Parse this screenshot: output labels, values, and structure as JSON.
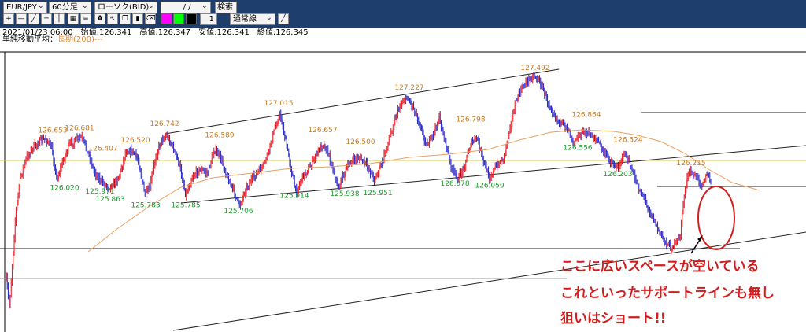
{
  "toolbar": {
    "symbol": "EUR/JPY",
    "timeframe": "60分足",
    "chart_style": "ローソク(BID)",
    "date_input": "/ /",
    "search_button": "検索",
    "line_width": "1",
    "line_type": "通常線",
    "bg_color": "#1e3f6d",
    "swatch_colors": [
      "#ff00ff",
      "#00ff00",
      "#000000"
    ]
  },
  "info": {
    "datetime": "2021/01/23 06:00",
    "open": "始値:126.341",
    "high": "高値:126.347",
    "low": "安値:126.341",
    "close": "終値:126.345",
    "indicator_label": "単純移動平均",
    "indicator_value": "長期(200)"
  },
  "annotation": {
    "lines": [
      "ここに広いスペースが空いている",
      "これといったサポートラインも無し",
      "狙いはショート!!"
    ],
    "color": "#d31c1c"
  },
  "chart_data": {
    "type": "candlestick",
    "symbol": "EUR/JPY",
    "timeframe": "60分足",
    "moving_average": "単純移動平均 長期(200)",
    "high_labels": [
      {
        "value": 126.653,
        "label": "126.653"
      },
      {
        "value": 126.681,
        "label": "126.681"
      },
      {
        "value": 126.407,
        "label": "126.407"
      },
      {
        "value": 126.52,
        "label": "126.520"
      },
      {
        "value": 126.742,
        "label": "126.742"
      },
      {
        "value": 126.589,
        "label": "126.589"
      },
      {
        "value": 127.015,
        "label": "127.015"
      },
      {
        "value": 126.657,
        "label": "126.657"
      },
      {
        "value": 126.5,
        "label": "126.500"
      },
      {
        "value": 127.227,
        "label": "127.227"
      },
      {
        "value": 126.798,
        "label": "126.798"
      },
      {
        "value": 127.492,
        "label": "127.492"
      },
      {
        "value": 126.864,
        "label": "126.864"
      },
      {
        "value": 126.524,
        "label": "126.524"
      },
      {
        "value": 126.215,
        "label": "126.215"
      }
    ],
    "low_labels": [
      {
        "value": 126.02,
        "label": "126.020"
      },
      {
        "value": 125.971,
        "label": "125.971"
      },
      {
        "value": 125.863,
        "label": "125.863"
      },
      {
        "value": 125.783,
        "label": "125.783"
      },
      {
        "value": 125.785,
        "label": "125.785"
      },
      {
        "value": 125.706,
        "label": "125.706"
      },
      {
        "value": 125.914,
        "label": "125.914"
      },
      {
        "value": 125.938,
        "label": "125.938"
      },
      {
        "value": 125.951,
        "label": "125.951"
      },
      {
        "value": 126.078,
        "label": "126.078"
      },
      {
        "value": 126.05,
        "label": "126.050"
      },
      {
        "value": 126.556,
        "label": "126.556"
      },
      {
        "value": 126.203,
        "label": "126.203"
      }
    ],
    "series_colors": {
      "up": "#e8202a",
      "down": "#3030c8",
      "ma": "#e8a060",
      "high_label": "#c87820",
      "low_label": "#1a9a2a"
    }
  }
}
